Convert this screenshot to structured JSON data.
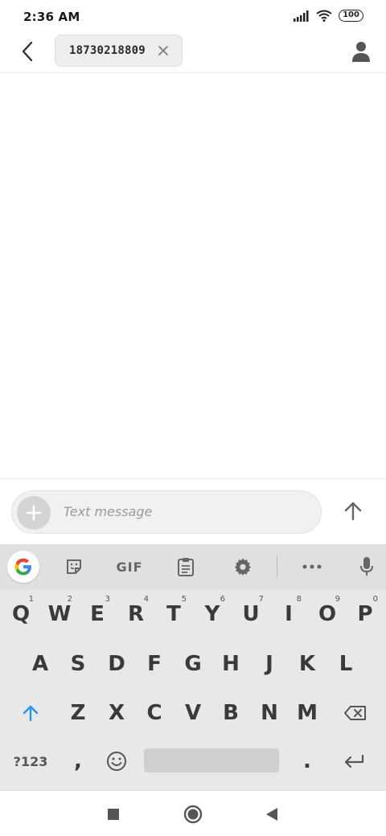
{
  "status_bar": {
    "time": "2:36 AM",
    "battery": "100",
    "icons": [
      "signal-icon",
      "wifi-icon",
      "battery-icon"
    ]
  },
  "header": {
    "back_icon": "back-arrow-icon",
    "recipient": "18730218809",
    "remove_icon": "close-icon",
    "contact_icon": "person-icon"
  },
  "compose": {
    "attach_icon": "plus-icon",
    "placeholder": "Text message",
    "send_icon": "arrow-up-icon"
  },
  "keyboard": {
    "toolbar": {
      "items": [
        "google-icon",
        "sticker-icon",
        "GIF",
        "clipboard-icon",
        "gear-icon",
        "more-icon",
        "mic-icon"
      ],
      "gif_label": "GIF"
    },
    "row1": [
      {
        "key": "Q",
        "sub": "1"
      },
      {
        "key": "W",
        "sub": "2"
      },
      {
        "key": "E",
        "sub": "3"
      },
      {
        "key": "R",
        "sub": "4"
      },
      {
        "key": "T",
        "sub": "5"
      },
      {
        "key": "Y",
        "sub": "6"
      },
      {
        "key": "U",
        "sub": "7"
      },
      {
        "key": "I",
        "sub": "8"
      },
      {
        "key": "O",
        "sub": "9"
      },
      {
        "key": "P",
        "sub": "0"
      }
    ],
    "row2": [
      "A",
      "S",
      "D",
      "F",
      "G",
      "H",
      "J",
      "K",
      "L"
    ],
    "row3": [
      "Z",
      "X",
      "C",
      "V",
      "B",
      "N",
      "M"
    ],
    "row4": {
      "symbols": "?123",
      "comma": ",",
      "period": ".",
      "emoji_icon": "emoji-icon",
      "enter_icon": "enter-icon"
    },
    "accent_color": "#2196f3"
  },
  "nav_bar": {
    "icons": [
      "recents-icon",
      "home-icon",
      "back-icon"
    ]
  }
}
